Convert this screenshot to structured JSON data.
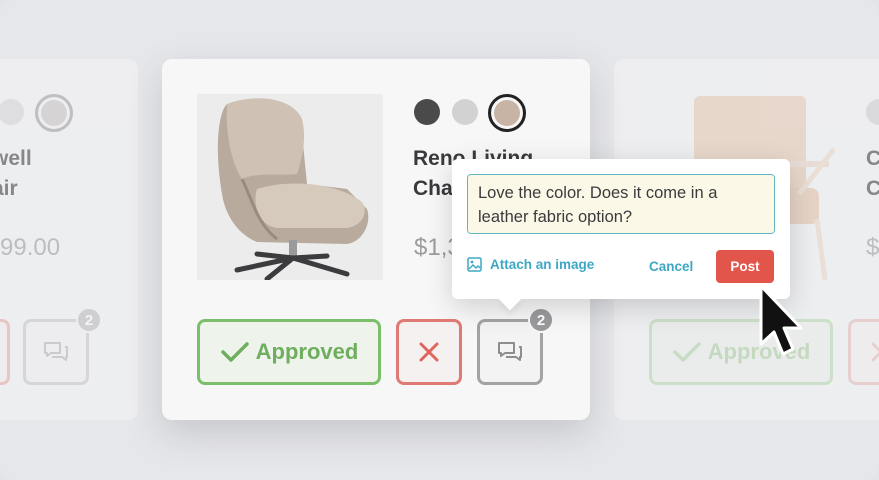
{
  "cards": {
    "left": {
      "title": "well\nair",
      "price": "99.00",
      "badge": "2"
    },
    "main": {
      "title": "Reno Living\nChair",
      "price": "$1,3",
      "approve_label": "Approved",
      "badge": "2",
      "swatches": [
        "#4a4a4a",
        "#d2d2d2",
        "#c7b4a5"
      ],
      "selected_swatch": 3
    },
    "right": {
      "title": "C\nC",
      "price": "$",
      "approve_label": "Approved"
    }
  },
  "popover": {
    "comment_text": "Love the color. Does it come in a leather fabric option?",
    "attach_label": "Attach an image",
    "cancel_label": "Cancel",
    "post_label": "Post"
  },
  "colors": {
    "approve": "#7cbf6b",
    "reject": "#e07a74",
    "link": "#3ea8c4",
    "post": "#e2554b"
  },
  "icons": [
    "check-icon",
    "close-icon",
    "comment-icon",
    "image-icon",
    "mouse-cursor-icon"
  ]
}
